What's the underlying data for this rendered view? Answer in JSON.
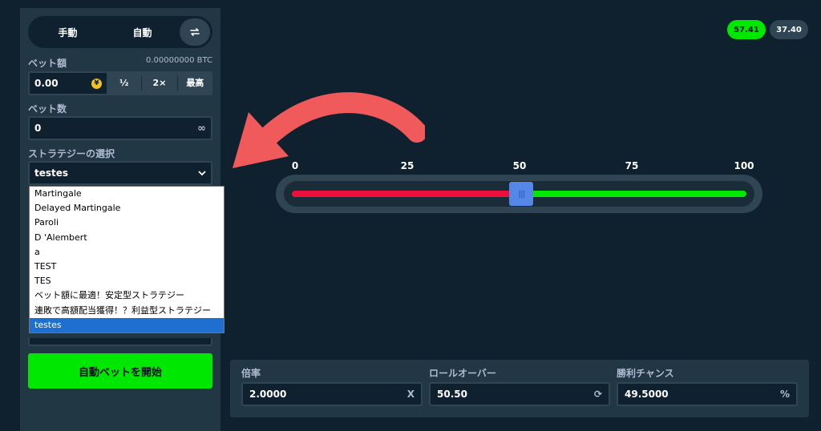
{
  "mode_tabs": {
    "manual": "手動",
    "auto": "自動",
    "toggle_icon": "swap-icon"
  },
  "bet_amount": {
    "label": "ベット額",
    "btc_value": "0.00000000 BTC",
    "value": "0.00",
    "coin_icon": "¥",
    "half": "½",
    "double": "2×",
    "max": "最高"
  },
  "bet_count": {
    "label": "ベット数",
    "value": "0",
    "icon": "∞"
  },
  "strategy": {
    "label": "ストラテジーの選択",
    "selected": "testes",
    "options": [
      "Martingale",
      "Delayed Martingale",
      "Paroli",
      "D 'Alembert",
      "a",
      "TEST",
      "TES",
      "ベット額に最適！安定型ストラテジー",
      "連敗で高額配当獲得！？利益型ストラテジー",
      "testes"
    ]
  },
  "start_button": "自動ベットを開始",
  "recent_results": [
    {
      "value": "57.41",
      "status": "win"
    },
    {
      "value": "37.40",
      "status": "neutral"
    }
  ],
  "slider": {
    "ticks": [
      "0",
      "25",
      "50",
      "75",
      "100"
    ],
    "value": 50.5,
    "thumb_glyph": "|||"
  },
  "multiplier": {
    "label": "倍率",
    "value": "2.0000",
    "suffix": "X"
  },
  "roll_over": {
    "label": "ロールオーバー",
    "value": "50.50",
    "suffix": "⟳"
  },
  "win_chance": {
    "label": "勝利チャンス",
    "value": "49.5000",
    "suffix": "%"
  },
  "colors": {
    "bg": "#0f212e",
    "panel": "#213743",
    "green": "#00e701",
    "red": "#e9113c",
    "arrow": "#f05a5a"
  }
}
